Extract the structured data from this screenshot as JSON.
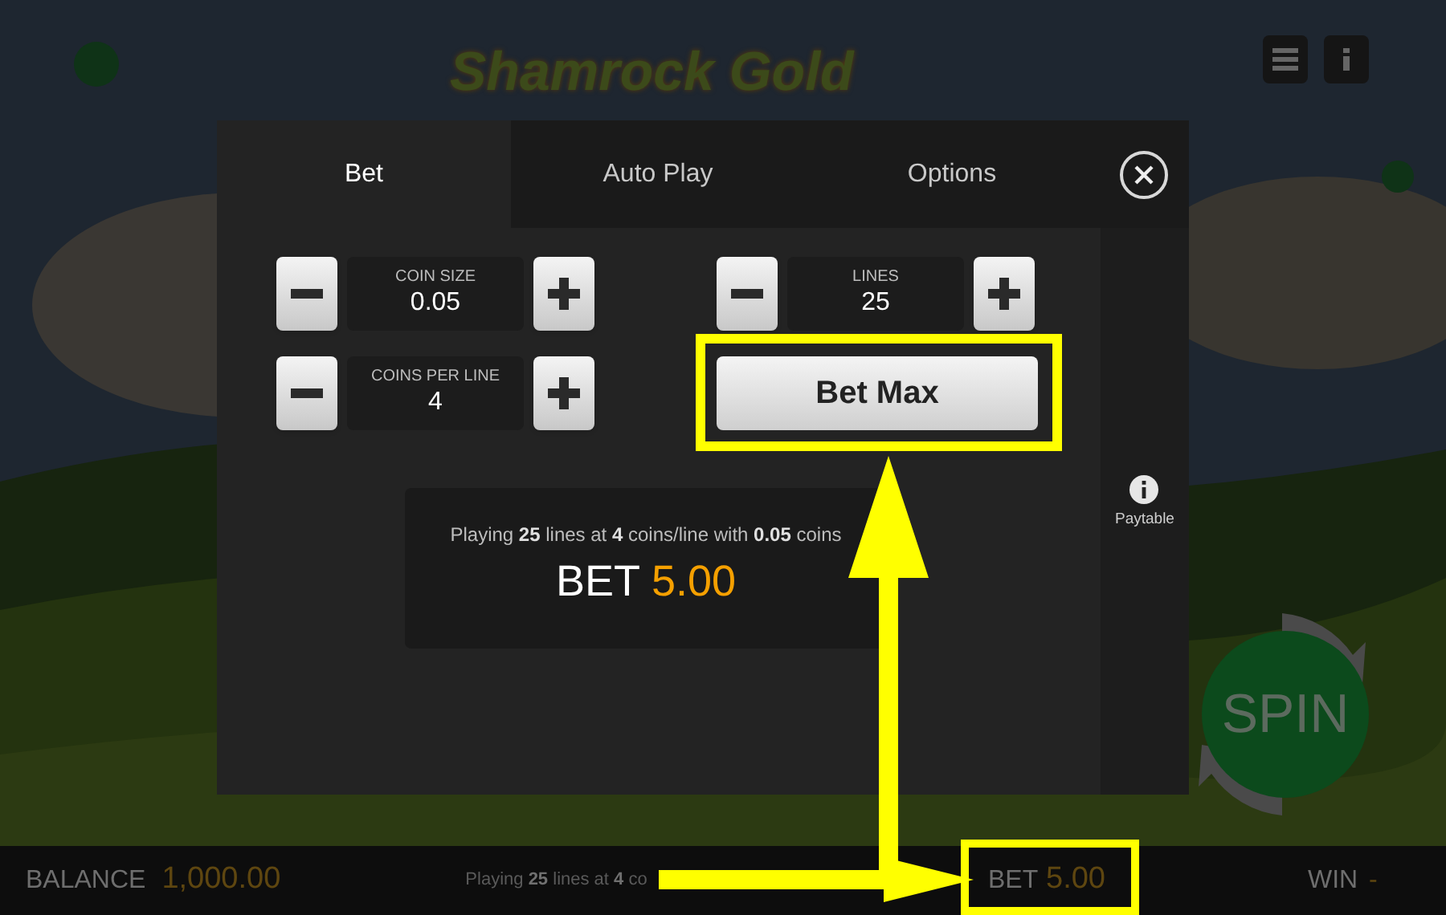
{
  "game": {
    "logo": "Shamrock Gold",
    "spin": "SPIN"
  },
  "dialog": {
    "tabs": [
      {
        "label": "Bet",
        "selected": true
      },
      {
        "label": "Auto Play",
        "selected": false
      },
      {
        "label": "Options",
        "selected": false
      }
    ],
    "steppers": [
      {
        "label": "COIN SIZE",
        "value": "0.05"
      },
      {
        "label": "LINES",
        "value": "25"
      },
      {
        "label": "COINS PER LINE",
        "value": "4"
      }
    ],
    "bet_max": "Bet Max",
    "summary": {
      "text": "Playing **25** lines at **4** coins/line with **0.05** coins",
      "bet_label": "BET",
      "bet_value": "5.00"
    },
    "paytable": "Paytable"
  },
  "status_bar": {
    "balance_label": "BALANCE",
    "balance": "1,000.00",
    "message": "Playing **25** lines at **4** co",
    "bet_label": "BET",
    "bet": "5.00",
    "win_label": "WIN",
    "win": "-"
  }
}
